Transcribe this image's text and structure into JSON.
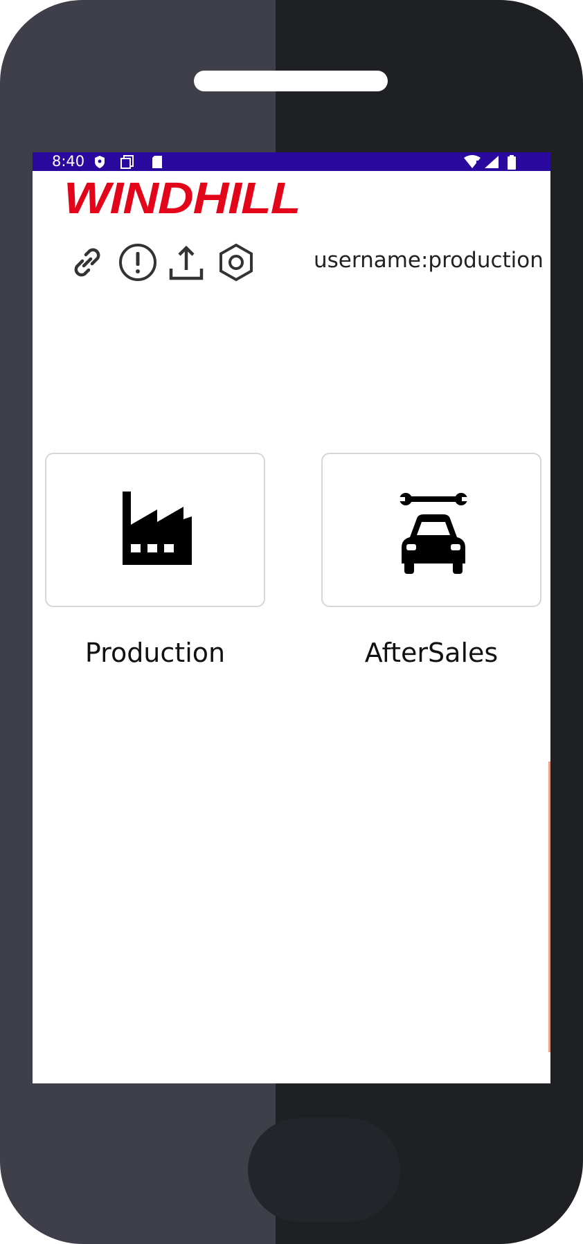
{
  "status_bar": {
    "time": "8:40",
    "left_icons": [
      "shield-icon",
      "document-icon",
      "sim-card-icon"
    ],
    "right_icons": [
      "wifi-alert-icon",
      "cellular-signal-icon",
      "battery-icon"
    ],
    "background_color": "#2a0a9e"
  },
  "header": {
    "logo_text": "WINDHILL",
    "logo_color": "#e3061b",
    "toolbar_icons": [
      "link-icon",
      "alert-circle-icon",
      "upload-icon",
      "settings-hex-icon"
    ],
    "username_label": "username:production"
  },
  "tiles": [
    {
      "label": "Production",
      "icon": "factory-icon"
    },
    {
      "label": "AfterSales",
      "icon": "car-service-icon"
    }
  ]
}
